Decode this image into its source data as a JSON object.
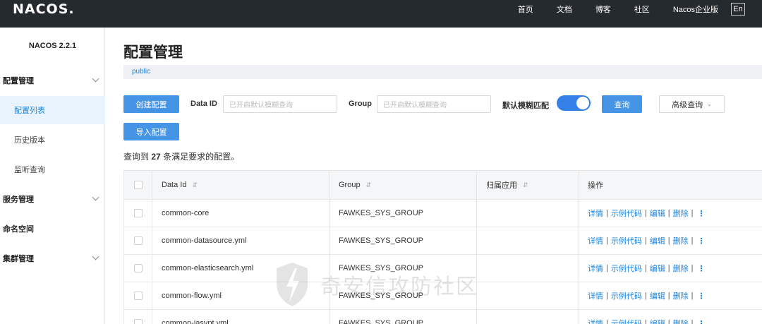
{
  "header": {
    "logo": "NACOS.",
    "nav": [
      "首页",
      "文档",
      "博客",
      "社区",
      "Nacos企业版"
    ],
    "lang": "En"
  },
  "sidebar": {
    "version": "NACOS 2.2.1",
    "items": [
      {
        "label": "配置管理",
        "type": "group"
      },
      {
        "label": "配置列表",
        "type": "sub",
        "active": true
      },
      {
        "label": "历史版本",
        "type": "sub"
      },
      {
        "label": "监听查询",
        "type": "sub"
      },
      {
        "label": "服务管理",
        "type": "group"
      },
      {
        "label": "命名空间",
        "type": "group"
      },
      {
        "label": "集群管理",
        "type": "group"
      }
    ]
  },
  "main": {
    "title": "配置管理",
    "namespace": "public",
    "create_button": "创建配置",
    "import_button": "导入配置",
    "data_id_label": "Data ID",
    "data_id_placeholder": "已开启默认模糊查询",
    "group_label": "Group",
    "group_placeholder": "已开启默认模糊查询",
    "fuzzy_label": "默认模糊匹配",
    "fuzzy_enabled": true,
    "search_button": "查询",
    "advanced_button": "高级查询",
    "summary_prefix": "查询到",
    "summary_count": "27",
    "summary_suffix": "条满足要求的配置。"
  },
  "table": {
    "columns": [
      "Data Id",
      "Group",
      "归属应用",
      "操作"
    ],
    "rows": [
      {
        "data_id": "common-core",
        "group": "FAWKES_SYS_GROUP",
        "app": ""
      },
      {
        "data_id": "common-datasource.yml",
        "group": "FAWKES_SYS_GROUP",
        "app": ""
      },
      {
        "data_id": "common-elasticsearch.yml",
        "group": "FAWKES_SYS_GROUP",
        "app": ""
      },
      {
        "data_id": "common-flow.yml",
        "group": "FAWKES_SYS_GROUP",
        "app": ""
      },
      {
        "data_id": "common-jasypt.yml",
        "group": "FAWKES_SYS_GROUP",
        "app": ""
      }
    ],
    "actions": [
      "详情",
      "示例代码",
      "编辑",
      "删除"
    ]
  },
  "watermark": "奇安信攻防社区",
  "colors": {
    "topbar": "#252a2f",
    "primary": "#4594e5",
    "link": "#1d85e0",
    "active_bg": "#e9f4fe"
  }
}
